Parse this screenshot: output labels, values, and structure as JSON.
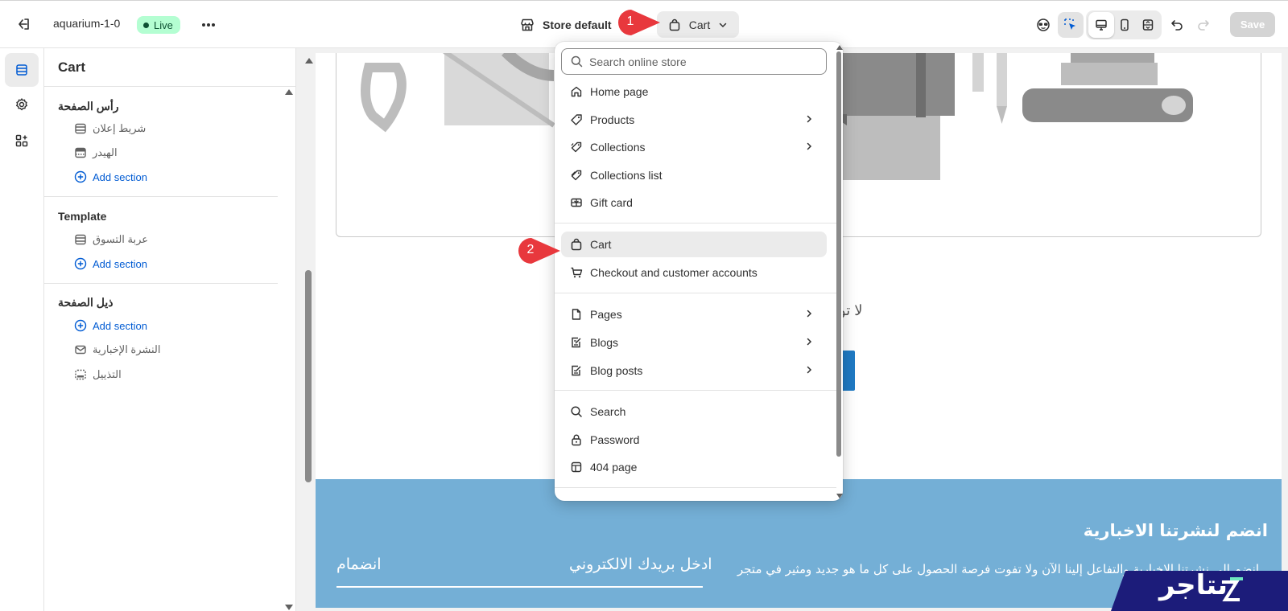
{
  "topbar": {
    "store_name": "aquarium-1-0",
    "status_badge": "Live",
    "theme_name": "Store default",
    "page_selector": "Cart",
    "save_label": "Save"
  },
  "panel": {
    "title": "Cart",
    "groups": [
      {
        "title": "رأس الصفحة",
        "items": [
          {
            "label": "شريط إعلان",
            "icon": "section-icon"
          },
          {
            "label": "الهيدر",
            "icon": "header-icon"
          }
        ],
        "add_label": "Add section"
      },
      {
        "title": "Template",
        "items": [
          {
            "label": "عربة التسوق",
            "icon": "section-icon"
          }
        ],
        "add_label": "Add section"
      },
      {
        "title": "ذيل الصفحة",
        "add_label": "Add section",
        "items": [
          {
            "label": "النشرة الإخبارية",
            "icon": "email-icon"
          },
          {
            "label": "التذييل",
            "icon": "footer-icon"
          }
        ]
      }
    ]
  },
  "dropdown": {
    "search_placeholder": "Search online store",
    "items": [
      {
        "label": "Home page",
        "icon": "home-icon",
        "has_submenu": false
      },
      {
        "label": "Products",
        "icon": "tag-icon",
        "has_submenu": true
      },
      {
        "label": "Collections",
        "icon": "collection-icon",
        "has_submenu": true
      },
      {
        "label": "Collections list",
        "icon": "collection-list-icon",
        "has_submenu": false
      },
      {
        "label": "Gift card",
        "icon": "gift-card-icon",
        "has_submenu": false
      },
      {
        "label": "Cart",
        "icon": "cart-bag-icon",
        "has_submenu": false,
        "selected": true
      },
      {
        "label": "Checkout and customer accounts",
        "icon": "checkout-cart-icon",
        "has_submenu": false
      },
      {
        "label": "Pages",
        "icon": "page-icon",
        "has_submenu": true
      },
      {
        "label": "Blogs",
        "icon": "blog-icon",
        "has_submenu": true
      },
      {
        "label": "Blog posts",
        "icon": "blog-post-icon",
        "has_submenu": true
      },
      {
        "label": "Search",
        "icon": "search-icon",
        "has_submenu": false
      },
      {
        "label": "Password",
        "icon": "lock-icon",
        "has_submenu": false
      },
      {
        "label": "404 page",
        "icon": "page-404-icon",
        "has_submenu": false
      }
    ]
  },
  "preview": {
    "cart_empty_fragment": "لا تو",
    "newsletter_title": "انضم لنشرتنا الاخبارية",
    "newsletter_text": "انضم الي نشرتنا الاخبارية والتفاعل إلينا الآن ولا تفوت فرصة الحصول على كل ما هو جديد ومثير في متجر",
    "email_placeholder": "ادخل بريدك الالكتروني",
    "join_label": "انضمام"
  },
  "annotations": {
    "marker_1": "1",
    "marker_2": "2"
  },
  "brand": {
    "watermark_text": "نتاجر"
  },
  "colors": {
    "accent_blue": "#005bd3",
    "live_badge_bg": "#b4fed2",
    "newsletter_bg": "#74afd6",
    "marker_red": "#e8383d",
    "brand_navy": "#1c1c7a"
  }
}
